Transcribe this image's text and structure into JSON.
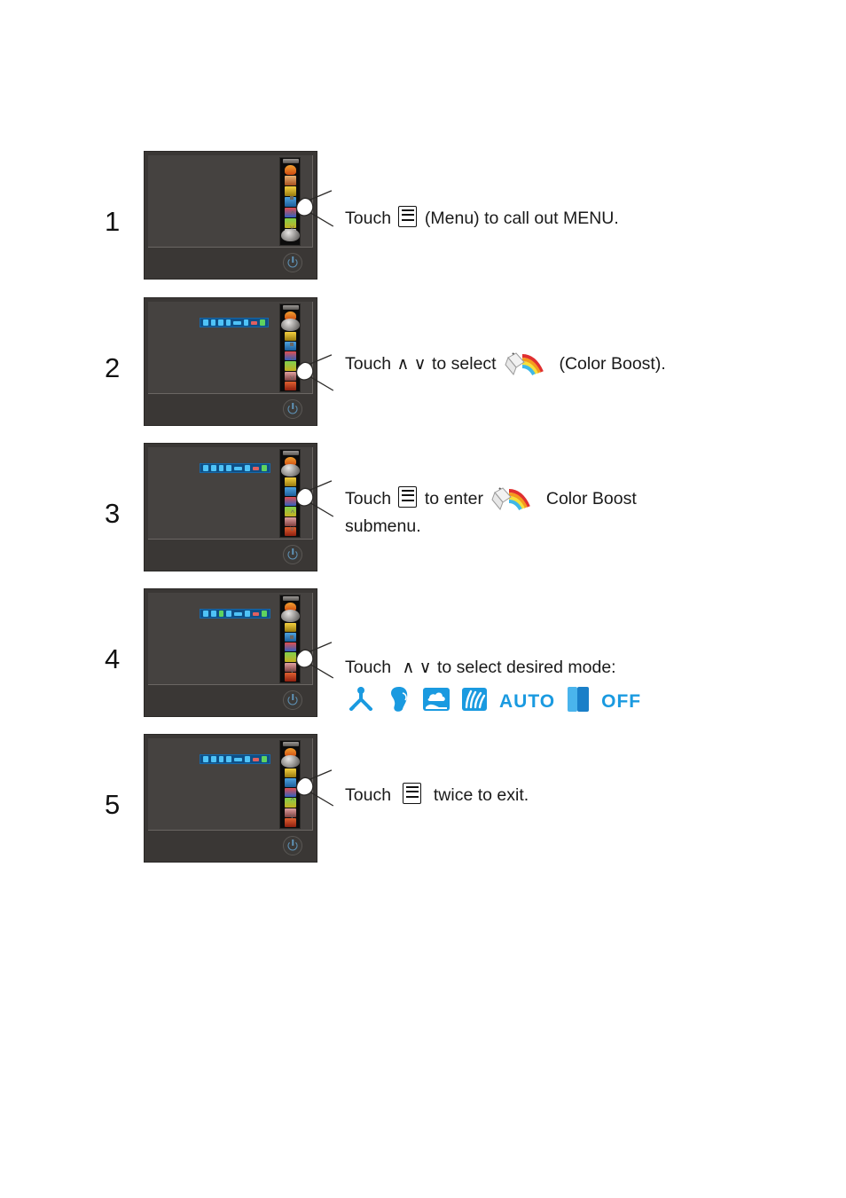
{
  "document": {
    "type": "monitor-osd-instruction-page",
    "title": "Color Boost setup steps"
  },
  "accent_colors": {
    "mode_icon_blue": "#1a9ae0",
    "osd_bar_blue": "#0f4f86",
    "osd_bar_icon": "#4fc3f7",
    "monitor_body": "#3a3735",
    "monitor_screen": "#454240",
    "power_led": "#5f93b8",
    "text": "#1a1a1a"
  },
  "steps": [
    {
      "number": "1",
      "lines": [
        "Touch ",
        " (Menu) to  call out MENU."
      ],
      "text_before_glyph": "Touch",
      "text_after_glyph": "(Menu) to  call out MENU.",
      "glyph": "menu-icon",
      "osd": {
        "sidebar_visible": true,
        "cursor_index": 6,
        "mode_bar_visible": false
      }
    },
    {
      "number": "2",
      "text_before_glyph": "Touch",
      "arrow_keys": "∧ ∨",
      "text_middle": "to select",
      "glyph": "color-boost-icon",
      "text_after_glyph": "(Color Boost).",
      "osd": {
        "sidebar_visible": true,
        "cursor_index": 0,
        "mode_bar_visible": true
      }
    },
    {
      "number": "3",
      "text_before_glyph": "Touch",
      "glyph": "menu-icon",
      "text_middle": "to enter",
      "glyph2": "color-boost-icon",
      "text_after_glyph": "Color Boost",
      "second_line": "submenu.",
      "osd": {
        "sidebar_visible": true,
        "cursor_index": 0,
        "mode_bar_visible": true
      }
    },
    {
      "number": "4",
      "text_before_glyph": "Touch",
      "arrow_keys": "∧ ∨",
      "text_middle": "to select desired  mode:",
      "osd": {
        "sidebar_visible": true,
        "cursor_index": 0,
        "mode_bar_visible": true
      },
      "modes": [
        {
          "name": "full-boost-icon",
          "label": "",
          "kind": "icon"
        },
        {
          "name": "skin-tone-icon",
          "label": "",
          "kind": "icon"
        },
        {
          "name": "sky-boost-icon",
          "label": "",
          "kind": "icon"
        },
        {
          "name": "grass-boost-icon",
          "label": "",
          "kind": "icon"
        },
        {
          "name": "auto-label",
          "label": "AUTO",
          "kind": "word"
        },
        {
          "name": "nature-skin-icon",
          "label": "",
          "kind": "icon"
        },
        {
          "name": "off-label",
          "label": "OFF",
          "kind": "word"
        }
      ]
    },
    {
      "number": "5",
      "text_before_glyph": "Touch",
      "glyph": "menu-icon",
      "text_after_glyph": "twice to exit.",
      "osd": {
        "sidebar_visible": true,
        "cursor_index": 0,
        "mode_bar_visible": true
      }
    }
  ]
}
